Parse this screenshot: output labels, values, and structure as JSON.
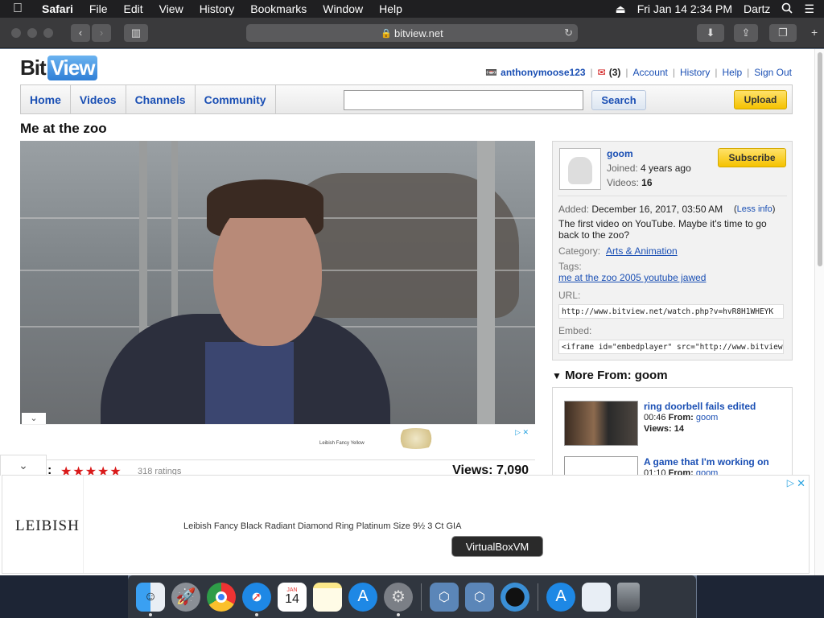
{
  "menubar": {
    "app": "Safari",
    "menus": [
      "File",
      "Edit",
      "View",
      "History",
      "Bookmarks",
      "Window",
      "Help"
    ],
    "datetime": "Fri Jan 14  2:34 PM",
    "user": "Dartz"
  },
  "browser": {
    "url": "bitview.net"
  },
  "site": {
    "logo_bit": "Bit",
    "logo_view": "View",
    "username": "anthonymoose123",
    "message_count": "(3)",
    "links": [
      "Account",
      "History",
      "Help",
      "Sign Out"
    ],
    "nav": [
      "Home",
      "Videos",
      "Channels",
      "Community"
    ],
    "search_value": "",
    "search_button": "Search",
    "upload_button": "Upload"
  },
  "video": {
    "title": "Me at the zoo",
    "rating_label": ":",
    "stars": "★★★★★",
    "rating_count": "318 ratings",
    "views": "Views: 7,090",
    "ad_text": "Leibish Fancy Yellow"
  },
  "info": {
    "owner": "goom",
    "joined_label": "Joined:",
    "joined_value": "4 years ago",
    "videos_label": "Videos:",
    "videos_value": "16",
    "subscribe": "Subscribe",
    "added_label": "Added:",
    "added_value": "December 16, 2017, 03:50 AM",
    "less_info": "Less info",
    "description": "The first video on YouTube. Maybe it's time to go back to the zoo?",
    "category_label": "Category:",
    "category_value": "Arts & Animation",
    "tags_label": "Tags:",
    "tags_value": "me at the zoo 2005 youtube jawed",
    "url_label": "URL:",
    "url_value": "http://www.bitview.net/watch.php?v=hvR8H1WHEYK",
    "embed_label": "Embed:",
    "embed_value": "<iframe id=\"embedplayer\" src=\"http://www.bitview.net/e"
  },
  "more_from": {
    "heading": "More From: goom",
    "items": [
      {
        "title": "ring doorbell fails edited",
        "duration": "00:46",
        "from_label": "From:",
        "from": "goom",
        "views": "Views: 14"
      },
      {
        "title": "A game that I'm working on",
        "duration": "01:10",
        "from_label": "From:",
        "from": "goom",
        "views": ""
      }
    ]
  },
  "ad_banner": {
    "brand": "LEIBISH",
    "text": "Leibish Fancy Black Radiant Diamond Ring Platinum Size 9½ 3 Ct GIA"
  },
  "dock": {
    "tooltip": "VirtualBoxVM",
    "calendar_month": "JAN",
    "calendar_day": "14"
  }
}
